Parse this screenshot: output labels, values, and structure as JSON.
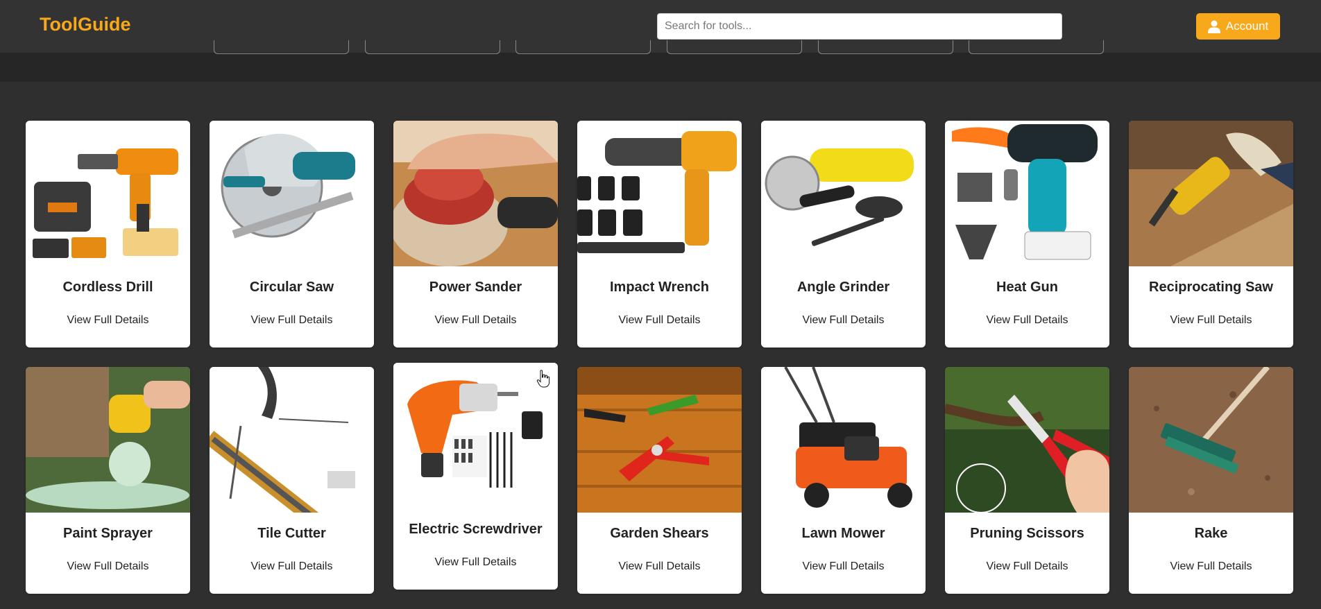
{
  "header": {
    "brand": "ToolGuide",
    "search": {
      "placeholder": "Search for tools...",
      "value": ""
    },
    "account_label": "Account",
    "accent_color": "#f7a81b"
  },
  "tools": [
    {
      "name": "Cordless Drill",
      "link": "View Full Details",
      "icon": "cordless-drill"
    },
    {
      "name": "Circular Saw",
      "link": "View Full Details",
      "icon": "circular-saw"
    },
    {
      "name": "Power Sander",
      "link": "View Full Details",
      "icon": "power-sander"
    },
    {
      "name": "Impact Wrench",
      "link": "View Full Details",
      "icon": "impact-wrench"
    },
    {
      "name": "Angle Grinder",
      "link": "View Full Details",
      "icon": "angle-grinder"
    },
    {
      "name": "Heat Gun",
      "link": "View Full Details",
      "icon": "heat-gun"
    },
    {
      "name": "Reciprocating Saw",
      "link": "View Full Details",
      "icon": "reciprocating-saw"
    },
    {
      "name": "Paint Sprayer",
      "link": "View Full Details",
      "icon": "paint-sprayer"
    },
    {
      "name": "Tile Cutter",
      "link": "View Full Details",
      "icon": "tile-cutter"
    },
    {
      "name": "Electric Screwdriver",
      "link": "View Full Details",
      "icon": "electric-screwdriver"
    },
    {
      "name": "Garden Shears",
      "link": "View Full Details",
      "icon": "garden-shears"
    },
    {
      "name": "Lawn Mower",
      "link": "View Full Details",
      "icon": "lawn-mower"
    },
    {
      "name": "Pruning Scissors",
      "link": "View Full Details",
      "icon": "pruning-scissors"
    },
    {
      "name": "Rake",
      "link": "View Full Details",
      "icon": "rake"
    }
  ]
}
